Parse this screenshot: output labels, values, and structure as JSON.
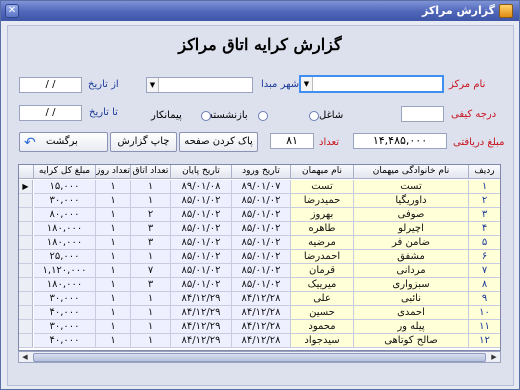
{
  "window": {
    "title": "گزارش مراکز"
  },
  "report_title": "گزارش کرایه اتاق مراکز",
  "filters": {
    "center_label": "نام مرکز",
    "center_value": "",
    "origin_city_label": "شهر مبدا",
    "origin_city_value": "",
    "from_date_label": "از تاریخ",
    "from_date_value": "/      /",
    "to_date_label": "تا تاریخ",
    "to_date_value": "/      /",
    "quality_label": "درجه کیفی",
    "quality_value": "",
    "radio_options": [
      "شاغل",
      "بازنشسته",
      "پیمانکار"
    ],
    "amount_label": "مبلغ دریافتی",
    "amount_value": "۱۴,۴۸۵,۰۰۰",
    "count_label": "تعداد",
    "count_value": "۸۱"
  },
  "buttons": {
    "clear": "پاک کردن صفحه",
    "print": "چاپ گزارش",
    "back": "برگشت"
  },
  "grid": {
    "columns": [
      "ردیف",
      "نام خانوادگی میهمان",
      "نام میهمان",
      "تاریخ ورود",
      "تاریخ پایان",
      "تعداد اتاق",
      "تعداد روز",
      "مبلغ کل کرایه"
    ],
    "rows": [
      [
        "۱",
        "تست",
        "تست",
        "۸۹/۰۱/۰۷",
        "۸۹/۰۱/۰۸",
        "۱",
        "۱",
        "۱۵,۰۰۰"
      ],
      [
        "۲",
        "داوریگیا",
        "حمیدرضا",
        "۸۵/۰۱/۰۲",
        "۸۵/۰۱/۰۲",
        "۱",
        "۱",
        "۳۰,۰۰۰"
      ],
      [
        "۳",
        "صوفی",
        "بهروز",
        "۸۵/۰۱/۰۲",
        "۸۵/۰۱/۰۲",
        "۲",
        "۱",
        "۸۰,۰۰۰"
      ],
      [
        "۴",
        "اچیرلو",
        "طاهره",
        "۸۵/۰۱/۰۲",
        "۸۵/۰۱/۰۲",
        "۳",
        "۱",
        "۱۸۰,۰۰۰"
      ],
      [
        "۵",
        "ضامن فر",
        "مرضیه",
        "۸۵/۰۱/۰۲",
        "۸۵/۰۱/۰۲",
        "۳",
        "۱",
        "۱۸۰,۰۰۰"
      ],
      [
        "۶",
        "مشفق",
        "احمدرضا",
        "۸۵/۰۱/۰۲",
        "۸۵/۰۱/۰۲",
        "۱",
        "۱",
        "۲۵,۰۰۰"
      ],
      [
        "۷",
        "مردانی",
        "قرمان",
        "۸۵/۰۱/۰۲",
        "۸۵/۰۱/۰۲",
        "۷",
        "۱",
        "۱,۱۲۰,۰۰۰"
      ],
      [
        "۸",
        "سبزواری",
        "میرییک",
        "۸۵/۰۱/۰۲",
        "۸۵/۰۱/۰۲",
        "۳",
        "۱",
        "۱۸۰,۰۰۰"
      ],
      [
        "۹",
        "نائبی",
        "علی",
        "۸۴/۱۲/۲۸",
        "۸۴/۱۲/۲۹",
        "۱",
        "۱",
        "۳۰,۰۰۰"
      ],
      [
        "۱۰",
        "احمدی",
        "حسین",
        "۸۴/۱۲/۲۸",
        "۸۴/۱۲/۲۹",
        "۱",
        "۱",
        "۴۰,۰۰۰"
      ],
      [
        "۱۱",
        "پیله ور",
        "محمود",
        "۸۴/۱۲/۲۸",
        "۸۴/۱۲/۲۹",
        "۱",
        "۱",
        "۳۰,۰۰۰"
      ],
      [
        "۱۲",
        "صالح کوتاهی",
        "سیدجواد",
        "۸۴/۱۲/۲۸",
        "۸۴/۱۲/۲۹",
        "۱",
        "۱",
        "۴۰,۰۰۰"
      ]
    ]
  },
  "colors": {
    "titlebar": "#4f66b9",
    "label_red": "#c8141e",
    "label_blue": "#1b3a9a",
    "grid_name_bg": "#ffffd8",
    "grid_data_bg": "#eef0ff"
  }
}
